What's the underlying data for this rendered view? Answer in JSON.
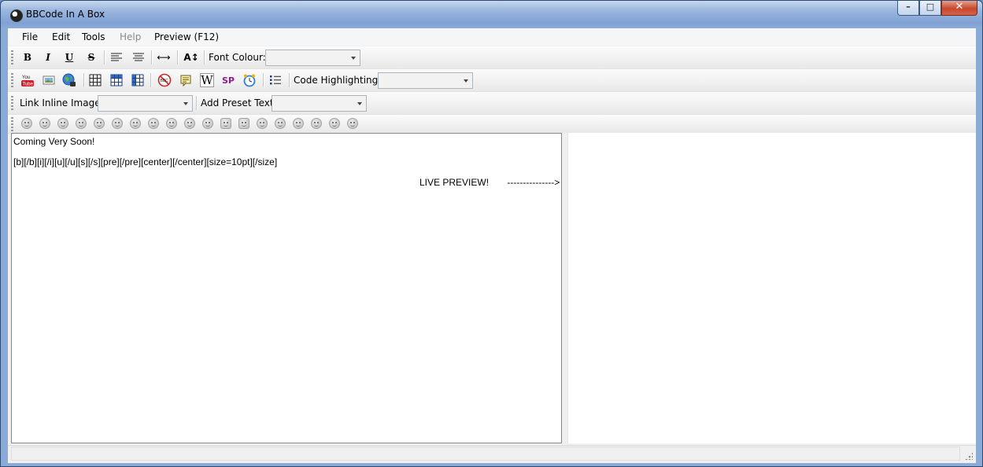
{
  "window": {
    "title": "BBCode In A Box"
  },
  "caption": {
    "minimize": "–",
    "maximize": "□",
    "close": "✕"
  },
  "menu": [
    {
      "label": "File",
      "disabled": false
    },
    {
      "label": "Edit",
      "disabled": false
    },
    {
      "label": "Tools",
      "disabled": false
    },
    {
      "label": "Help",
      "disabled": true
    },
    {
      "label": "Preview (F12)",
      "disabled": false
    }
  ],
  "toolbar1": {
    "bold": "B",
    "italic": "I",
    "underline": "U",
    "strike": "S",
    "width_icon": "⟷",
    "size_icon": "A↕",
    "font_colour_label": "Font Colour:",
    "font_colour_value": ""
  },
  "toolbar2": {
    "youtube": "You Tube",
    "wiki": "W",
    "sp": "SP",
    "code_highlighting_label": "Code Highlighting:",
    "code_highlighting_value": ""
  },
  "toolbar3": {
    "link_inline_image_label": "Link Inline Image:",
    "link_inline_image_value": "",
    "add_preset_text_label": "Add Preset Text:",
    "add_preset_text_value": ""
  },
  "editor": {
    "line1": "Coming Very Soon!",
    "line2": "[b][/b][i][/i][u][/u][s][/s][pre][/pre][center][/center][size=10pt][/size]",
    "line3": "LIVE PREVIEW!       --------------->"
  },
  "colors": {
    "accent": "#3c6bb1",
    "wiki": "#000000",
    "sp": "#8b1b8f"
  }
}
